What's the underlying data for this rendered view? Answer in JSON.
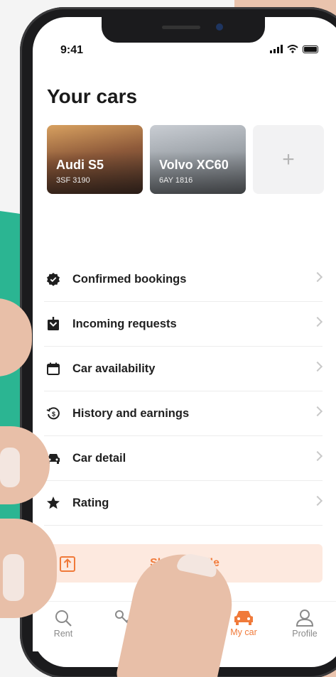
{
  "status": {
    "time": "9:41"
  },
  "page": {
    "title": "Your cars"
  },
  "cars": [
    {
      "name": "Audi S5",
      "plate": "3SF 3190"
    },
    {
      "name": "Volvo XC60",
      "plate": "6AY 1816"
    }
  ],
  "add_car": {
    "symbol": "+"
  },
  "menu": [
    {
      "label": "Confirmed bookings",
      "icon": "verified-badge-icon"
    },
    {
      "label": "Incoming requests",
      "icon": "inbox-download-icon"
    },
    {
      "label": "Car availability",
      "icon": "calendar-icon"
    },
    {
      "label": "History and earnings",
      "icon": "history-dollar-icon"
    },
    {
      "label": "Car detail",
      "icon": "car-icon"
    },
    {
      "label": "Rating",
      "icon": "star-icon"
    }
  ],
  "share": {
    "label": "Share profile",
    "icon": "upload-box-icon"
  },
  "tabbar": [
    {
      "label": "Rent",
      "icon": "search-icon"
    },
    {
      "label": "",
      "icon": "key-icon"
    },
    {
      "label": "",
      "icon": "chat-icon"
    },
    {
      "label": "My car",
      "icon": "car-icon",
      "active": true
    },
    {
      "label": "Profile",
      "icon": "user-icon"
    }
  ],
  "colors": {
    "accent": "#F07A3A",
    "accent_light": "#FDE9DF",
    "teal": "#2BB592"
  }
}
